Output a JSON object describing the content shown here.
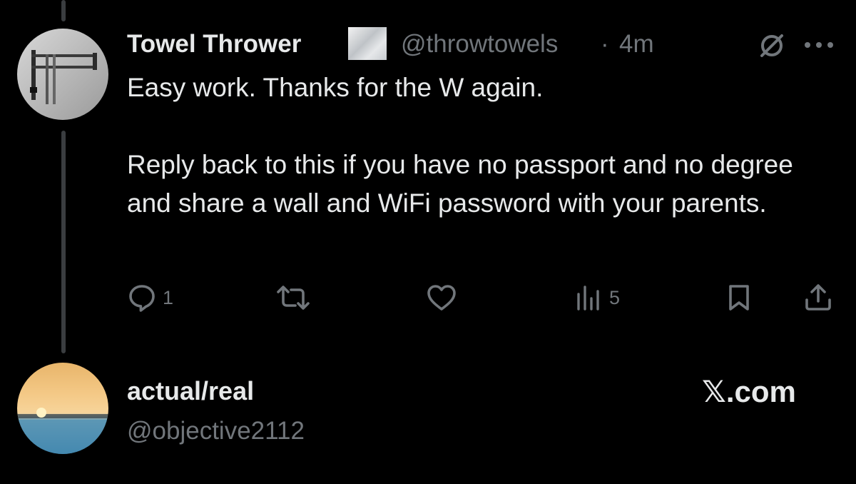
{
  "tweet": {
    "author_name": "Towel Thrower",
    "handle": "@throwtowels",
    "separator": "·",
    "time": "4m",
    "paragraphs": [
      "Easy work. Thanks for the W again.",
      "Reply back to this if you have no passport and no degree and share a wall and WiFi password with your parents."
    ],
    "actions": {
      "reply_count": "1",
      "repost_count": "",
      "like_count": "",
      "views_count": "5"
    }
  },
  "author_card": {
    "name": "actual/real",
    "handle": "@objective2112",
    "brand": "𝕏.com"
  },
  "icons": {
    "grok": "slashed-circle-icon",
    "more": "more-dots-icon",
    "reply": "reply-bubble-icon",
    "repost": "repost-arrows-icon",
    "like": "heart-icon",
    "views": "views-bars-icon",
    "bookmark": "bookmark-icon",
    "share": "share-icon"
  },
  "colors": {
    "background": "#000000",
    "text": "#e7e9ea",
    "muted": "#71767b"
  }
}
